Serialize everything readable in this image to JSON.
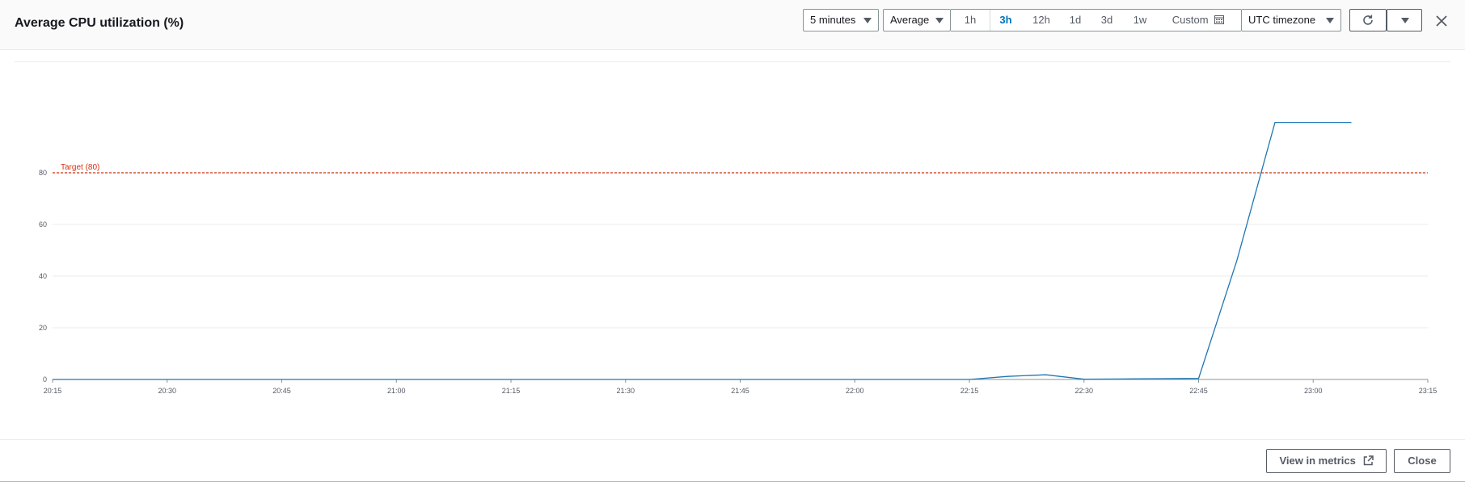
{
  "dialog": {
    "title": "Average CPU utilization (%)",
    "close_icon": "close-icon"
  },
  "toolbar": {
    "period": "5 minutes",
    "statistic": "Average",
    "ranges": [
      "1h",
      "3h",
      "12h",
      "1d",
      "3d",
      "1w"
    ],
    "active_range": "3h",
    "custom_label": "Custom",
    "custom_icon": "calendar-icon",
    "timezone": "UTC timezone",
    "refresh_icon": "refresh-icon",
    "refresh_options_icon": "caret-down-icon"
  },
  "footer": {
    "view_metrics_label": "View in metrics",
    "view_metrics_icon": "external-link-icon",
    "close_label": "Close"
  },
  "colors": {
    "series": "#1f77b4",
    "threshold": "#d13212",
    "active_range": "#0073bb"
  },
  "chart_data": {
    "type": "line",
    "title": "",
    "xlabel": "",
    "ylabel": "",
    "x_ticks": [
      "20:15",
      "20:30",
      "20:45",
      "21:00",
      "21:15",
      "21:30",
      "21:45",
      "22:00",
      "22:15",
      "22:30",
      "22:45",
      "23:00",
      "23:15"
    ],
    "y_ticks": [
      0,
      20,
      40,
      60,
      80
    ],
    "ylim": [
      0,
      100
    ],
    "xlim": [
      "20:15",
      "23:15"
    ],
    "grid": "horizontal",
    "series": [
      {
        "x": [
          "20:15",
          "20:20",
          "20:25",
          "20:30",
          "20:35",
          "20:40",
          "20:45",
          "20:50",
          "20:55",
          "21:00",
          "21:05",
          "21:10",
          "21:15",
          "21:20",
          "21:25",
          "21:30",
          "21:35",
          "21:40",
          "21:45",
          "21:50",
          "21:55",
          "22:00",
          "22:05",
          "22:10",
          "22:15",
          "22:20",
          "22:25",
          "22:30",
          "22:35",
          "22:40",
          "22:45",
          "22:50",
          "22:55",
          "23:00",
          "23:05"
        ],
        "values": [
          0,
          0,
          0,
          0,
          0,
          0,
          0,
          0,
          0,
          0,
          0,
          0,
          0,
          0,
          0,
          0,
          0,
          0,
          0,
          0,
          0,
          0,
          0,
          0,
          0,
          1.2,
          1.8,
          0.1,
          0.2,
          0.3,
          0.4,
          46,
          99.5,
          99.5,
          99.5
        ]
      }
    ],
    "threshold": {
      "label": "Target (80)",
      "value": 80
    }
  }
}
